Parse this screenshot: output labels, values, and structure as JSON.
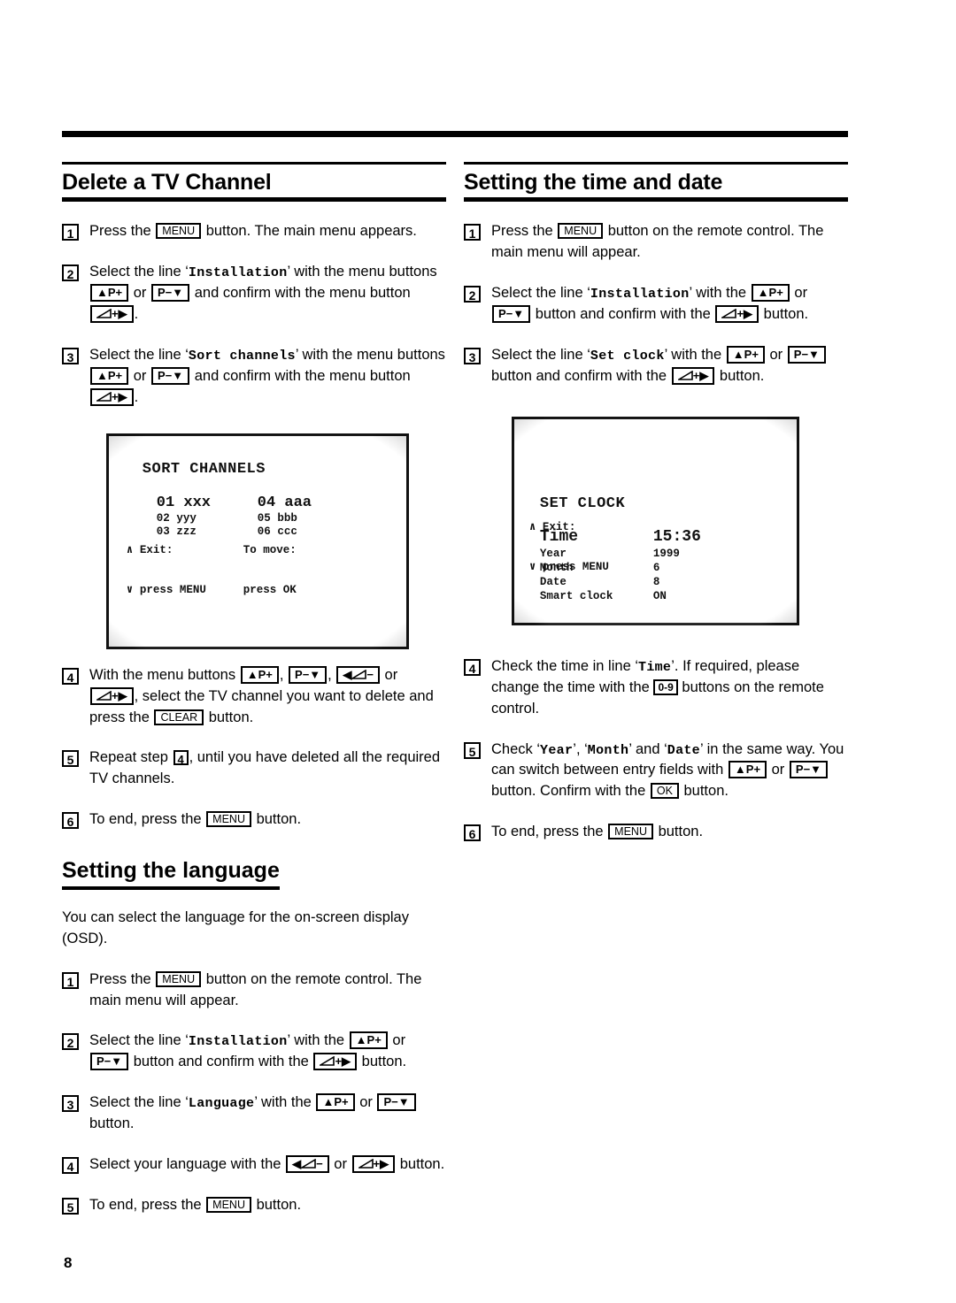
{
  "page": {
    "number": "8"
  },
  "sections": {
    "delete_channel": {
      "title": "Delete a TV Channel",
      "steps": [
        {
          "n": "1",
          "parts": [
            "Press the ",
            "MENU",
            " button. The main menu appears."
          ]
        },
        {
          "n": "2"
        },
        {
          "n": "3"
        },
        {
          "n": "4"
        },
        {
          "n": "5"
        },
        {
          "n": "6"
        }
      ],
      "s1": {
        "a": "Press the",
        "key": "MENU",
        "b": "button. The main menu appears."
      },
      "s2": {
        "a": "Select the line",
        "item": "Installation",
        "b": "with the menu buttons",
        "or": "or",
        "c": "and confirm with the menu button",
        "period": "."
      },
      "s3": {
        "a": "Select the line",
        "item": "Sort channels",
        "b": "with the menu buttons",
        "or": "or",
        "c": "and confirm with the menu button",
        "period": "."
      },
      "s4": {
        "a": "With the menu buttons",
        "comma": ",",
        "or": "or",
        "b": ", select the TV channel you want to delete and press the",
        "key": "CLEAR",
        "c": "button."
      },
      "s5": {
        "a": "Repeat step",
        "ref": "4",
        "b": ",  until you have deleted all the required TV channels."
      },
      "s6": {
        "a": "To end, press the",
        "key": "MENU",
        "b": "button."
      }
    },
    "set_language": {
      "title": "Setting the language",
      "intro": "You can select the language for the on-screen display (OSD).",
      "s1": {
        "a": "Press the",
        "key": "MENU",
        "b": "button on the remote control. The main menu will appear."
      },
      "s2": {
        "a": "Select the line",
        "item": "Installation",
        "b": "with the",
        "or": "or",
        "c": "button and confirm with the",
        "d": "button."
      },
      "s3": {
        "a": "Select the line",
        "item": "Language",
        "b": "with the",
        "or": "or",
        "c": "button."
      },
      "s4": {
        "a": "Select your language with the",
        "or": "or",
        "b": "button."
      },
      "s5": {
        "a": "To end, press the",
        "key": "MENU",
        "b": "button."
      },
      "nums": {
        "s1": "1",
        "s2": "2",
        "s3": "3",
        "s4": "4",
        "s5": "5"
      }
    },
    "time_date": {
      "title": "Setting the time and date",
      "s1": {
        "a": "Press the",
        "key": "MENU",
        "b": "button on the remote control. The main menu will appear."
      },
      "s2": {
        "a": "Select the line",
        "item": "Installation",
        "b": "with the",
        "or": "or",
        "c": "button and confirm with the",
        "d": "button."
      },
      "s3": {
        "a": "Select the line",
        "item": "Set clock",
        "b": "with the",
        "or": "or",
        "c": "button and confirm with the",
        "d": "button."
      },
      "s4": {
        "a": "Check the time in line",
        "item": "Time",
        "b": ". If required, please change the time with the",
        "key": "0-9",
        "c": "buttons on the remote control."
      },
      "s5": {
        "a": "Check",
        "i1": "Year",
        "comma1": ",",
        "i2": "Month",
        "and": "and",
        "i3": "Date",
        "b": "in the same way. You can switch between entry fields with",
        "or": "or",
        "c": "button. Confirm with the",
        "key": "OK",
        "d": "button."
      },
      "s6": {
        "a": "To end, press the",
        "key": "MENU",
        "b": "button."
      },
      "nums": {
        "s1": "1",
        "s2": "2",
        "s3": "3",
        "s4": "4",
        "s5": "5",
        "s6": "6"
      }
    }
  },
  "keys": {
    "menu": "MENU",
    "clear": "CLEAR",
    "ok": "OK",
    "digits": "0-9",
    "p_up": "P",
    "p_up_sign": "+",
    "p_down": "P",
    "p_down_sign": "−",
    "vol_up_sign": "+",
    "vol_down_sign": "−"
  },
  "tv_sort": {
    "title": "SORT CHANNELS",
    "channels_left": [
      {
        "num": "01",
        "name": "xxx",
        "highlight": true
      },
      {
        "num": "02",
        "name": "yyy",
        "highlight": false
      },
      {
        "num": "03",
        "name": "zzz",
        "highlight": false
      }
    ],
    "channels_right": [
      {
        "num": "04",
        "name": "aaa",
        "highlight": true
      },
      {
        "num": "05",
        "name": "bbb",
        "highlight": false
      },
      {
        "num": "06",
        "name": "ccc",
        "highlight": false
      }
    ],
    "footer_left_1": "∧ Exit:",
    "footer_left_2": "∨ press MENU",
    "footer_right_1": "To move:",
    "footer_right_2": "press OK"
  },
  "tv_clock": {
    "title": "SET CLOCK",
    "rows": [
      {
        "label": "Time",
        "value": "15:36",
        "big": true
      },
      {
        "label": "Year",
        "value": "1999",
        "big": false
      },
      {
        "label": "Month",
        "value": "6",
        "big": false
      },
      {
        "label": "Date",
        "value": "8",
        "big": false
      },
      {
        "label": "Smart clock",
        "value": "ON",
        "big": false
      }
    ],
    "footer_1": "∧ Exit:",
    "footer_2": "∨ press MENU"
  }
}
